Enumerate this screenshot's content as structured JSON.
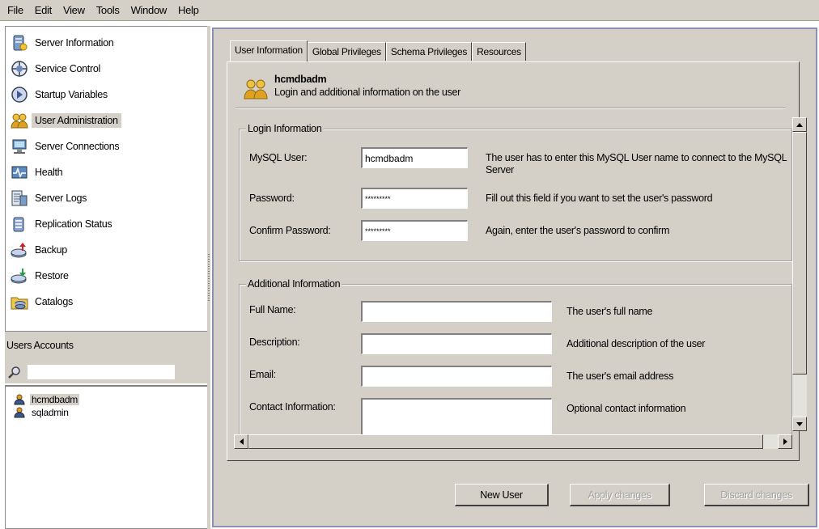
{
  "menu": [
    "File",
    "Edit",
    "View",
    "Tools",
    "Window",
    "Help"
  ],
  "nav": {
    "items": [
      {
        "label": "Server Information",
        "icon": "server-info-icon"
      },
      {
        "label": "Service Control",
        "icon": "service-control-icon"
      },
      {
        "label": "Startup Variables",
        "icon": "startup-variables-icon"
      },
      {
        "label": "User Administration",
        "icon": "user-admin-icon",
        "selected": true
      },
      {
        "label": "Server Connections",
        "icon": "server-connections-icon"
      },
      {
        "label": "Health",
        "icon": "health-icon"
      },
      {
        "label": "Server Logs",
        "icon": "server-logs-icon"
      },
      {
        "label": "Replication Status",
        "icon": "replication-icon"
      },
      {
        "label": "Backup",
        "icon": "backup-icon"
      },
      {
        "label": "Restore",
        "icon": "restore-icon"
      },
      {
        "label": "Catalogs",
        "icon": "catalogs-icon"
      }
    ]
  },
  "accounts": {
    "header": "Users Accounts",
    "search_value": "",
    "users": [
      {
        "name": "hcmdbadm",
        "selected": true
      },
      {
        "name": "sqladmin",
        "selected": false
      }
    ]
  },
  "tabs": [
    "User Information",
    "Global Privileges",
    "Schema Privileges",
    "Resources"
  ],
  "user_header": {
    "name": "hcmdbadm",
    "subtitle": "Login and additional information on the user"
  },
  "login": {
    "legend": "Login Information",
    "mysql_user_label": "MySQL User:",
    "mysql_user_value": "hcmdbadm",
    "mysql_user_help": "The user has to enter this MySQL User name to connect to the MySQL Server",
    "password_label": "Password:",
    "password_value": "*********",
    "password_help": "Fill out this field if you want to set the user's password",
    "confirm_label": "Confirm Password:",
    "confirm_value": "*********",
    "confirm_help": "Again, enter the user's password to confirm"
  },
  "additional": {
    "legend": "Additional Information",
    "fullname_label": "Full Name:",
    "fullname_value": "",
    "fullname_help": "The user's full name",
    "description_label": "Description:",
    "description_value": "",
    "description_help": "Additional description of the user",
    "email_label": "Email:",
    "email_value": "",
    "email_help": "The user's email address",
    "contact_label": "Contact Information:",
    "contact_value": "",
    "contact_help": "Optional contact information"
  },
  "buttons": {
    "new_user": "New User",
    "apply": "Apply changes",
    "discard": "Discard changes"
  },
  "colors": {
    "chrome": "#d4d0c8",
    "pane_border": "#8c8fb8"
  }
}
